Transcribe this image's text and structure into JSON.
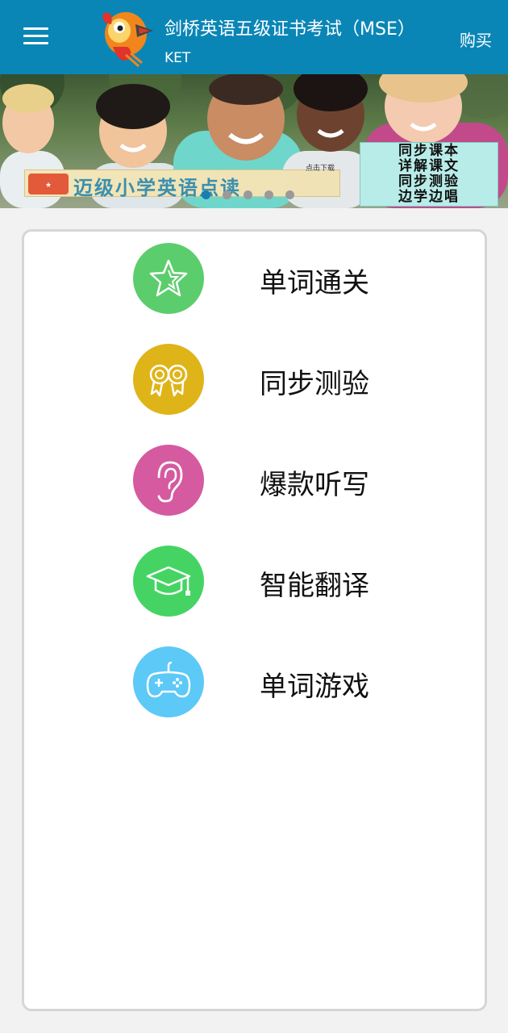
{
  "header": {
    "title": "剑桥英语五级证书考试（MSE）",
    "subtitle": "KET",
    "buy_label": "购买",
    "menu_icon": "hamburger-menu-icon",
    "logo_icon": "parrot-logo-icon",
    "background_color": "#0a86b6"
  },
  "banner": {
    "strip_text": "迈级小学英语点读",
    "strip_small": "点击下载",
    "box_lines": [
      "同步课本",
      "详解课文",
      "同步测验",
      "边学边唱"
    ],
    "slide_count": 5,
    "active_slide": 1
  },
  "menu": {
    "items": [
      {
        "label": "单词通关",
        "icon": "star-icon",
        "color": "#5ccd6c"
      },
      {
        "label": "同步测验",
        "icon": "award-ribbon-icon",
        "color": "#dfb419"
      },
      {
        "label": "爆款听写",
        "icon": "ear-icon",
        "color": "#d55aa0"
      },
      {
        "label": "智能翻译",
        "icon": "graduation-cap-icon",
        "color": "#45d464"
      },
      {
        "label": "单词游戏",
        "icon": "gamepad-icon",
        "color": "#5cc9f7"
      }
    ]
  }
}
